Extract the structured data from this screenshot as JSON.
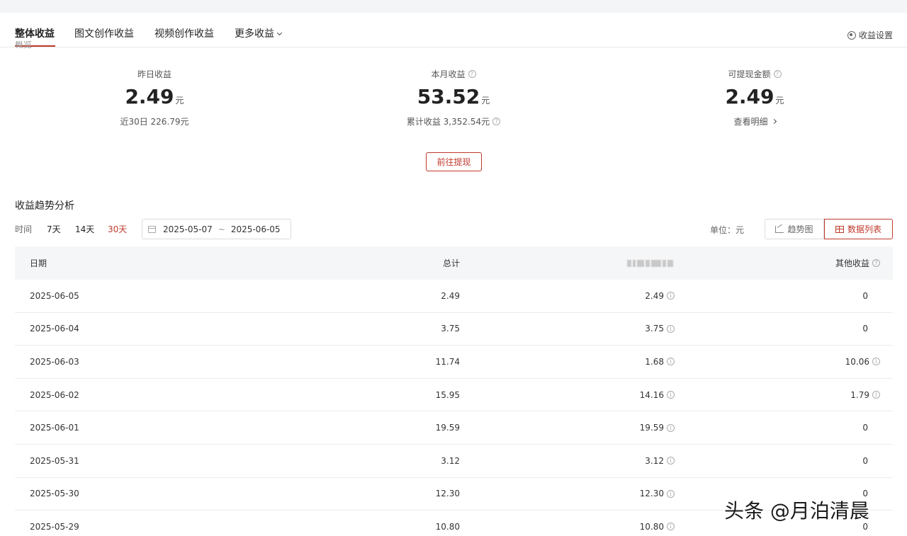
{
  "tabs": [
    {
      "label": "整体收益"
    },
    {
      "label": "图文创作收益"
    },
    {
      "label": "视频创作收益"
    },
    {
      "label": "更多收益"
    }
  ],
  "settings_label": "收益设置",
  "cut_text": "概览",
  "stats": {
    "yesterday": {
      "label": "昨日收益",
      "value": "2.49",
      "unit": "元",
      "sub": "近30日 226.79元"
    },
    "month": {
      "label": "本月收益",
      "value": "53.52",
      "unit": "元",
      "sub": "累计收益 3,352.54元"
    },
    "withdrawable": {
      "label": "可提现金额",
      "value": "2.49",
      "unit": "元",
      "sub": "查看明细"
    }
  },
  "withdraw_button": "前往提现",
  "trend": {
    "title": "收益趋势分析",
    "time_label": "时间",
    "ranges": [
      "7天",
      "14天",
      "30天"
    ],
    "active_range": "30天",
    "date_start": "2025-05-07",
    "date_sep": "~",
    "date_end": "2025-06-05",
    "unit_label": "单位：元",
    "view_trend": "趋势图",
    "view_list": "数据列表"
  },
  "table": {
    "headers": {
      "date": "日期",
      "total": "总计",
      "main": "",
      "other": "其他收益"
    },
    "rows": [
      {
        "date": "2025-06-05",
        "total": "2.49",
        "main": "2.49",
        "other": "0"
      },
      {
        "date": "2025-06-04",
        "total": "3.75",
        "main": "3.75",
        "other": "0"
      },
      {
        "date": "2025-06-03",
        "total": "11.74",
        "main": "1.68",
        "other": "10.06"
      },
      {
        "date": "2025-06-02",
        "total": "15.95",
        "main": "14.16",
        "other": "1.79"
      },
      {
        "date": "2025-06-01",
        "total": "19.59",
        "main": "19.59",
        "other": "0"
      },
      {
        "date": "2025-05-31",
        "total": "3.12",
        "main": "3.12",
        "other": "0"
      },
      {
        "date": "2025-05-30",
        "total": "12.30",
        "main": "12.30",
        "other": "0"
      },
      {
        "date": "2025-05-29",
        "total": "10.80",
        "main": "10.80",
        "other": "0"
      }
    ]
  },
  "watermark": "头条 @月泊清晨",
  "colors": {
    "accent": "#c0392b",
    "header_bg": "#f5f6f7"
  }
}
